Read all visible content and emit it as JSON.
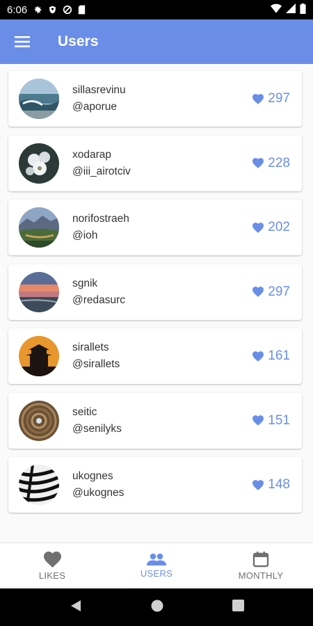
{
  "status_bar": {
    "time": "6:06"
  },
  "app_bar": {
    "title": "Users"
  },
  "users": [
    {
      "name": "sillasrevinu",
      "handle": "@aporue",
      "likes": "297",
      "avatar": "ocean-waves"
    },
    {
      "name": "xodarap",
      "handle": "@iii_airotciv",
      "likes": "228",
      "avatar": "white-flowers"
    },
    {
      "name": "norifostraeh",
      "handle": "@ioh",
      "likes": "202",
      "avatar": "mountain-landscape"
    },
    {
      "name": "sgnik",
      "handle": "@redasurc",
      "likes": "297",
      "avatar": "sunset-coast"
    },
    {
      "name": "sirallets",
      "handle": "@sirallets",
      "likes": "161",
      "avatar": "pagoda-silhouette"
    },
    {
      "name": "seitic",
      "handle": "@senilyks",
      "likes": "151",
      "avatar": "dome-ceiling"
    },
    {
      "name": "ukognes",
      "handle": "@ukognes",
      "likes": "148",
      "avatar": "zebra-stripes"
    }
  ],
  "bottom_nav": [
    {
      "label": "LIKES",
      "icon": "heart-icon",
      "active": false
    },
    {
      "label": "USERS",
      "icon": "people-icon",
      "active": true
    },
    {
      "label": "MONTHLY",
      "icon": "calendar-icon",
      "active": false
    }
  ],
  "colors": {
    "primary": "#6a8ee8",
    "text": "#333333",
    "inactive": "#707070"
  }
}
